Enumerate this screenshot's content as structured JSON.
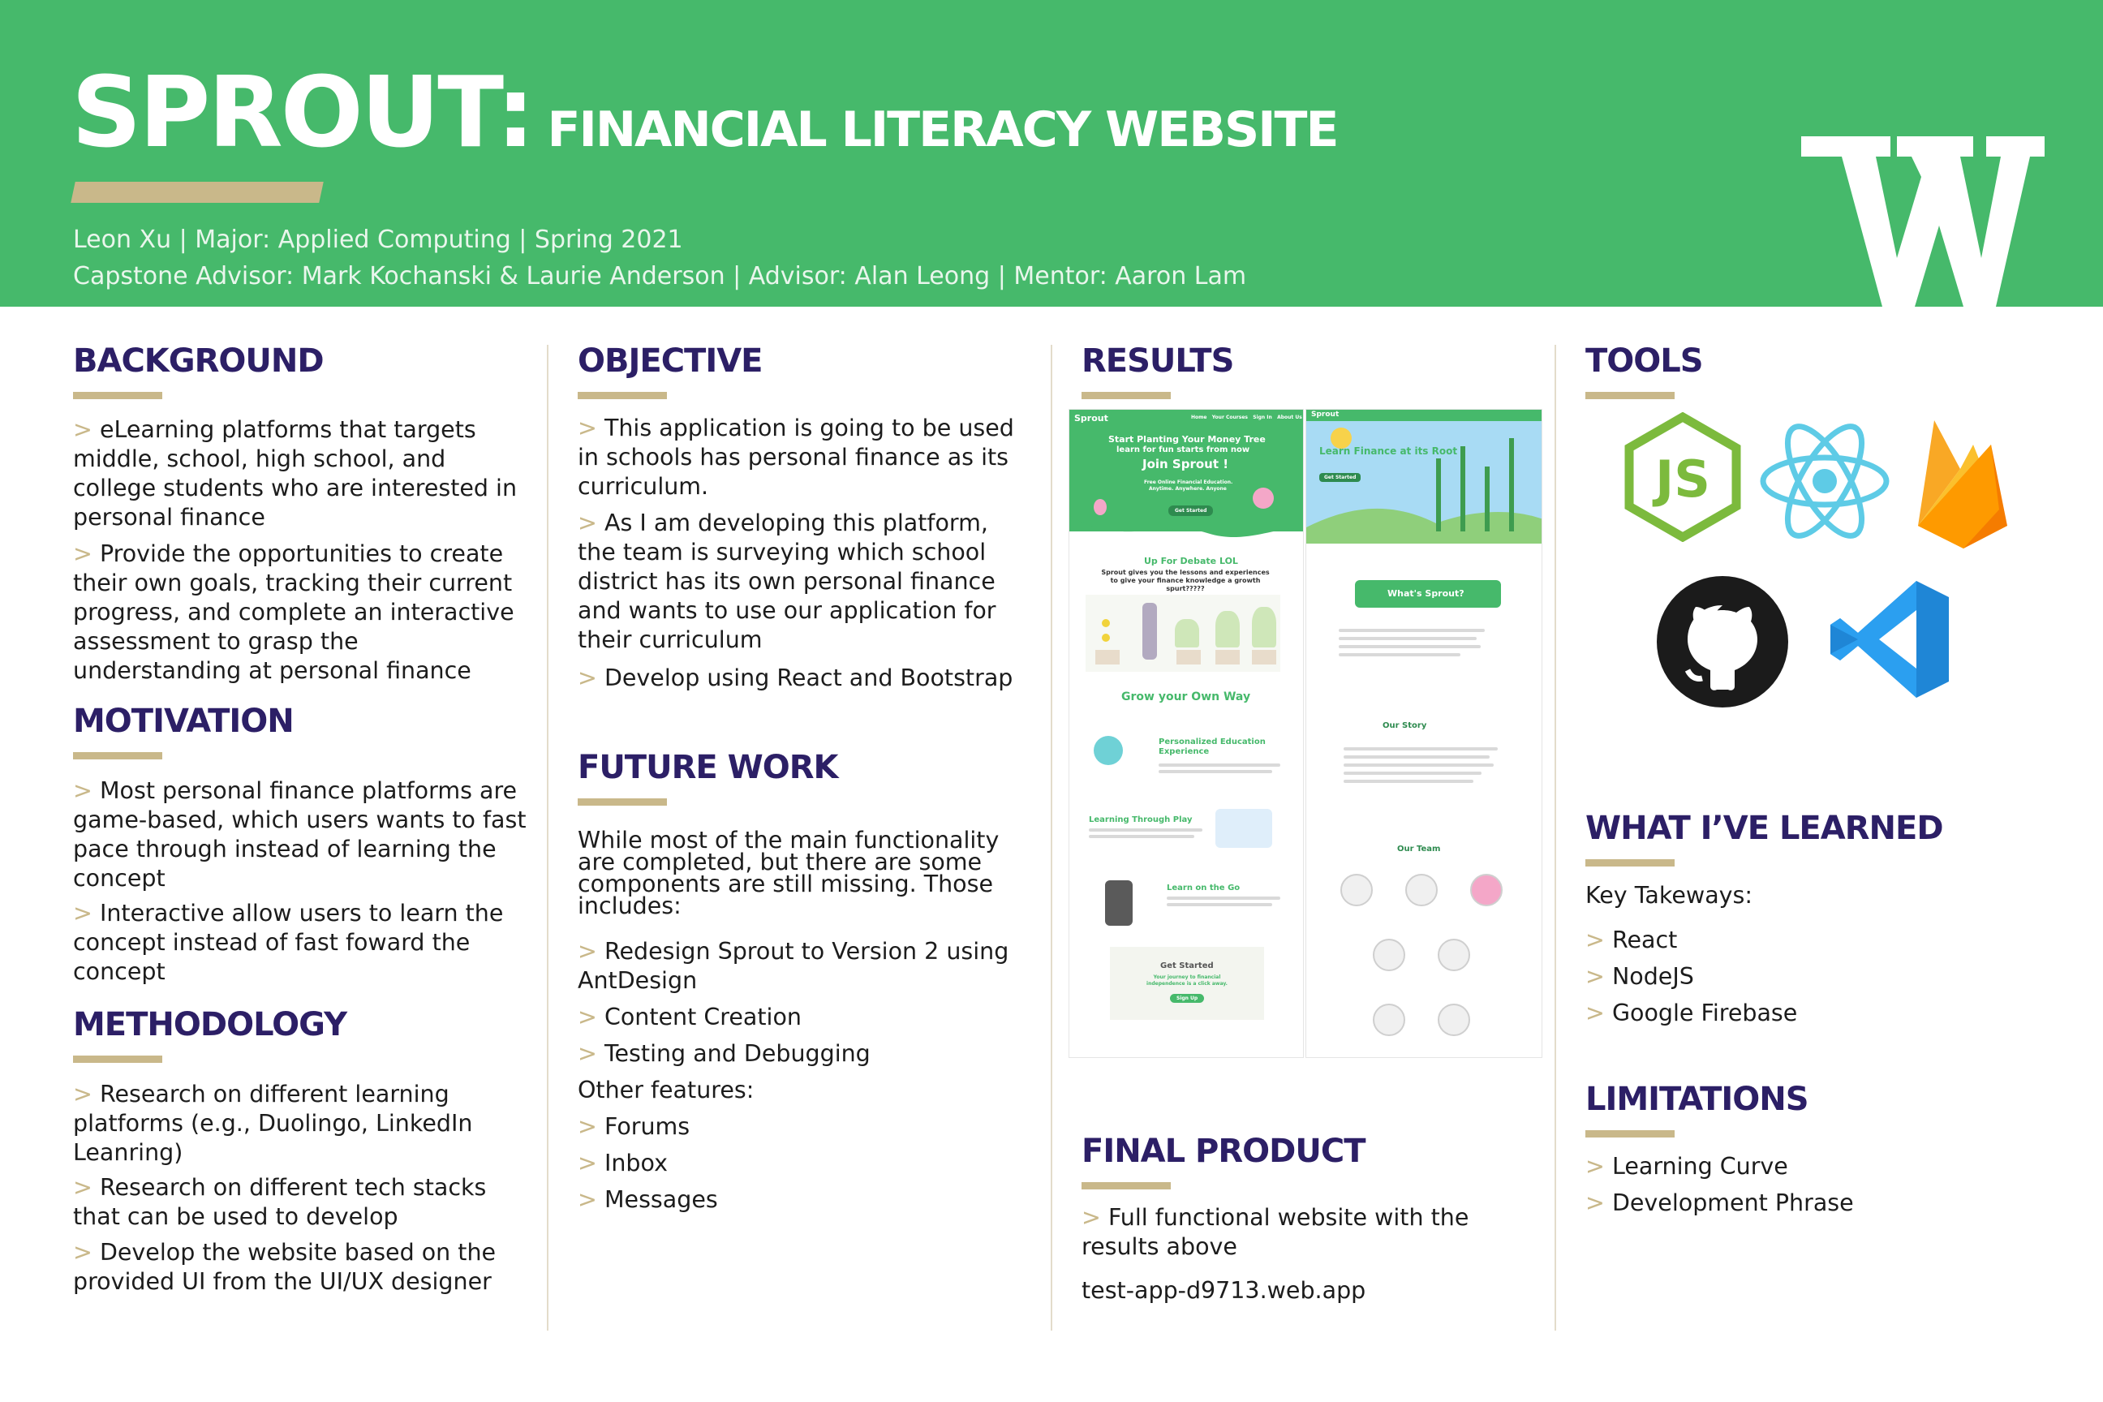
{
  "header": {
    "title_main": "SPROUT:",
    "title_sub": "FINANCIAL LITERACY WEBSITE",
    "meta_line1": "Leon Xu | Major: Applied Computing | Spring 2021",
    "meta_line2": "Capstone Advisor: Mark Kochanski & Laurie Anderson | Advisor: Alan Leong | Mentor: Aaron Lam",
    "logo": "W"
  },
  "background": {
    "heading": "BACKGROUND",
    "items": [
      "eLearning platforms that targets middle, school, high school, and college students who are interested in personal finance",
      "Provide the opportunities to create their own goals, tracking their current progress, and complete an interactive assessment to grasp the understanding at personal finance"
    ]
  },
  "motivation": {
    "heading": "MOTIVATION",
    "items": [
      "Most personal finance platforms are game-based, which users wants to fast pace through instead of learning the concept",
      "Interactive allow users to learn the concept instead of fast foward the concept"
    ]
  },
  "methodology": {
    "heading": "METHODOLOGY",
    "items": [
      "Research on different learning platforms (e.g., Duolingo, LinkedIn Leanring)",
      "Research on different tech stacks that can be used to develop",
      "Develop the website based on the provided UI from the UI/UX designer"
    ]
  },
  "objective": {
    "heading": "OBJECTIVE",
    "items": [
      "This application is going to be used in schools has personal finance as its curriculum.",
      "As I am developing this platform, the team is surveying which school district has its own personal finance and wants to use our application for their curriculum",
      "Develop using React and Bootstrap"
    ]
  },
  "future_work": {
    "heading": "FUTURE WORK",
    "intro": "While most of the main functionality are completed, but there are some components are still missing. Those includes:",
    "items": [
      "Redesign Sprout to Version 2 using AntDesign",
      "Content Creation",
      "Testing and Debugging"
    ],
    "other_label": "Other features:",
    "other_items": [
      "Forums",
      "Inbox",
      "Messages"
    ]
  },
  "results": {
    "heading": "RESULTS",
    "mock_left": {
      "brand": "Sprout",
      "nav": [
        "Home",
        "Your Courses",
        "Sign In",
        "About Us"
      ],
      "hero_line1": "Start Planting Your Money Tree",
      "hero_line2": "learn for fun starts from now",
      "hero_cta": "Join Sprout !",
      "hero_small1": "Free Online Financial Education.",
      "hero_small2": "Anytime. Anywhere. Anyone",
      "hero_button": "Get Started",
      "debate_title": "Up For Debate LOL",
      "debate_text": "Sprout gives you the lessons and experiences to give your finance knowledge a growth spurt?????",
      "grow_title": "Grow your Own Way",
      "feature1": "Personalized Education Experience",
      "feature2": "Learning Through Play",
      "feature3": "Learn on the Go",
      "cta_title": "Get Started",
      "cta_text": "Your journey to financial independence is a click away.",
      "cta_button": "Sign Up"
    },
    "mock_right": {
      "brand": "Sprout",
      "hero_title": "Learn Finance at its Root",
      "hero_button": "Get Started",
      "whats_title": "What's Sprout?",
      "story_title": "Our Story",
      "team_title": "Our Team"
    }
  },
  "final_product": {
    "heading": "FINAL PRODUCT",
    "item": "Full functional website with the results above",
    "url": "test-app-d9713.web.app"
  },
  "tools": {
    "heading": "TOOLS",
    "icons": [
      "nodejs-icon",
      "react-icon",
      "firebase-icon",
      "github-icon",
      "vscode-icon"
    ]
  },
  "learned": {
    "heading": "WHAT I’VE LEARNED",
    "intro": "Key Takeways:",
    "items": [
      "React",
      "NodeJS",
      "Google Firebase"
    ]
  },
  "limitations": {
    "heading": "LIMITATIONS",
    "items": [
      "Learning Curve",
      "Development Phrase"
    ]
  },
  "colors": {
    "header_green": "#46b96b",
    "heading_purple": "#2c1f66",
    "accent_gold": "#c9b88a"
  }
}
